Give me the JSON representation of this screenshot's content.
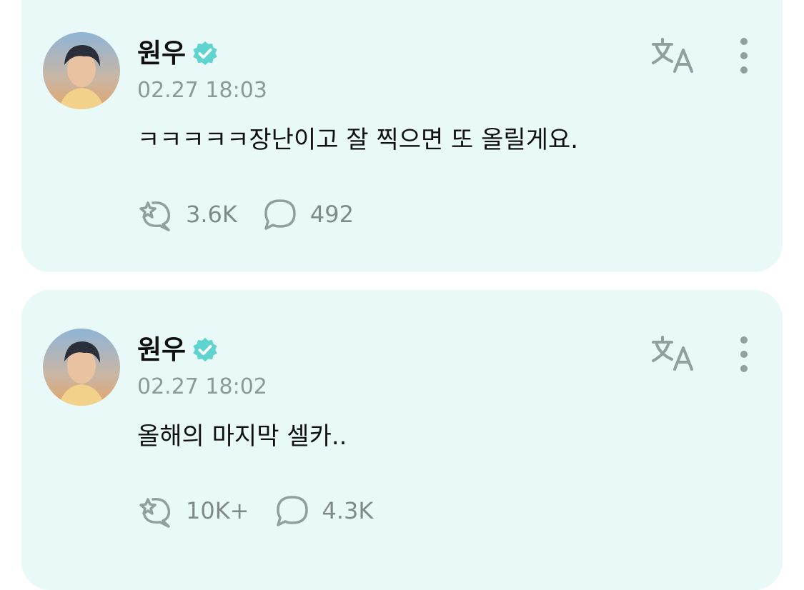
{
  "posts": [
    {
      "author": "원우",
      "verified": true,
      "timestamp": "02.27 18:03",
      "text": "ㅋㅋㅋㅋㅋ장난이고 잘 찍으면 또 올릴게요.",
      "likes": "3.6K",
      "comments": "492"
    },
    {
      "author": "원우",
      "verified": true,
      "timestamp": "02.27 18:02",
      "text": "올해의 마지막 셀카..",
      "likes": "10K+",
      "comments": "4.3K"
    }
  ],
  "icons": {
    "verified": "verified-badge-icon",
    "translate": "translate-icon",
    "more": "more-vertical-icon",
    "like": "sparkle-bubble-icon",
    "comment": "comment-bubble-icon"
  },
  "colors": {
    "card_background": "#e8f9f7",
    "verified_badge": "#5fd3cf",
    "icon_gray": "#8fa09e",
    "timestamp_gray": "#8b9a98"
  }
}
